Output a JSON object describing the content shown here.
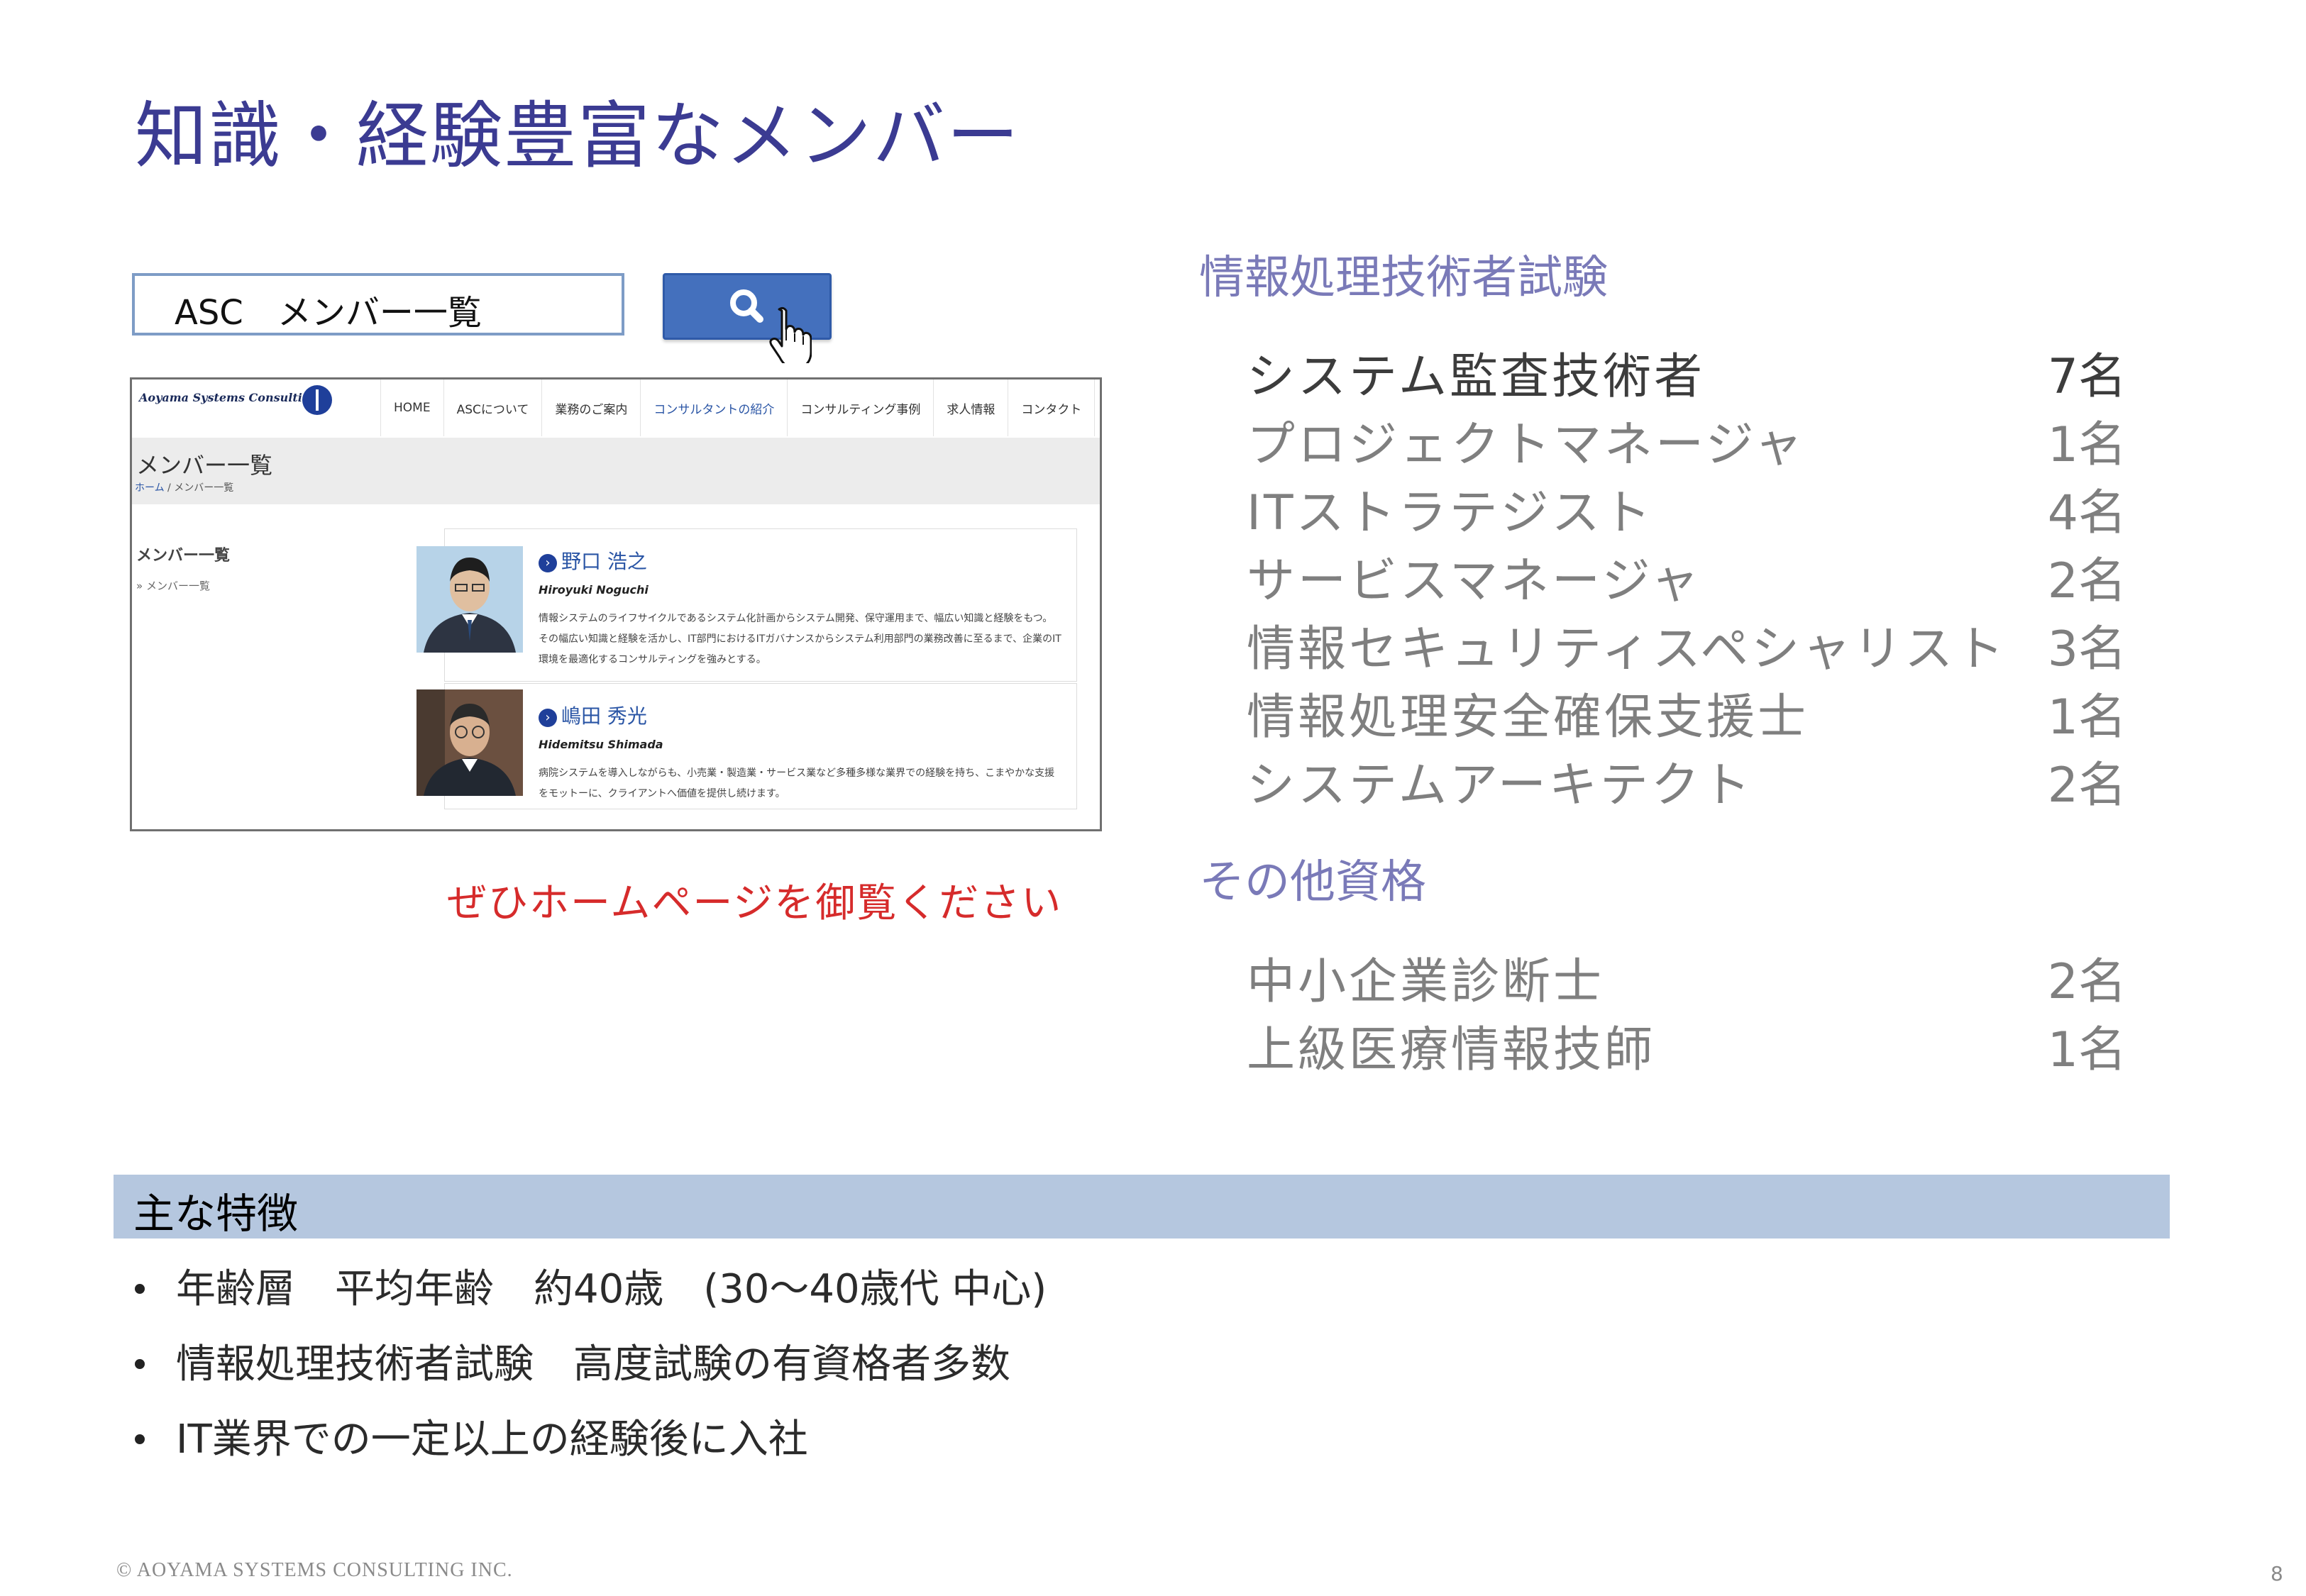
{
  "slide": {
    "title": "知識・経験豊富なメンバー",
    "page_number": "8",
    "copyright": "© AOYAMA SYSTEMS CONSULTING INC."
  },
  "search": {
    "query": "ASC　メンバー一覧",
    "button_icon": "search-icon",
    "cursor_icon": "hand-pointer-icon"
  },
  "website": {
    "logo_text": "Aoyama Systems Consulting",
    "nav": [
      "HOME",
      "ASCについて",
      "業務のご案内",
      "コンサルタントの紹介",
      "コンサルティング事例",
      "求人情報",
      "コンタクト"
    ],
    "page_title": "メンバー一覧",
    "breadcrumb_home": "ホーム",
    "breadcrumb_sep": " / ",
    "breadcrumb_current": "メンバー一覧",
    "sidebar_title": "メンバー一覧",
    "sidebar_item": "»  メンバー一覧",
    "members": [
      {
        "name": "野口 浩之",
        "roman": "Hiroyuki Noguchi",
        "desc": "情報システムのライフサイクルであるシステム化計画からシステム開発、保守運用まで、幅広い知識と経験をもつ。 その幅広い知識と経験を活かし、IT部門におけるITガバナンスからシステム利用部門の業務改善に至るまで、企業のIT環境を最適化するコンサルティングを強みとする。"
      },
      {
        "name": "嶋田 秀光",
        "roman": "Hidemitsu Shimada",
        "desc": "病院システムを導入しながらも、小売業・製造業・サービス業など多種多様な業界での経験を持ち、こまやかな支援をモットーに、クライアントへ価値を提供し続けます。"
      }
    ]
  },
  "note": "ぜひホームページを御覧ください",
  "qualifications": {
    "exam_heading": "情報処理技術者試験",
    "exam_items": [
      {
        "name": "システム監査技術者",
        "count": "7名"
      },
      {
        "name": "プロジェクトマネージャ",
        "count": "1名"
      },
      {
        "name": "ITストラテジスト",
        "count": "4名"
      },
      {
        "name": "サービスマネージャ",
        "count": "2名"
      },
      {
        "name": "情報セキュリティスペシャリスト",
        "count": "3名"
      },
      {
        "name": "情報処理安全確保支援士",
        "count": "1名"
      },
      {
        "name": "システムアーキテクト",
        "count": "2名"
      }
    ],
    "other_heading": "その他資格",
    "other_items": [
      {
        "name": "中小企業診断士",
        "count": "2名"
      },
      {
        "name": "上級医療情報技師",
        "count": "1名"
      }
    ]
  },
  "features": {
    "heading": "主な特徴",
    "items": [
      "年齢層　平均年齢　約40歳　(30～40歳代 中心)",
      "情報処理技術者試験　高度試験の有資格者多数",
      "IT業界での一定以上の経験後に入社"
    ]
  },
  "colors": {
    "title": "#3b3b92",
    "section_heading": "#7a7ab8",
    "note": "#d62b2b",
    "feature_band": "#b5c7df",
    "search_button": "#4470bd"
  }
}
